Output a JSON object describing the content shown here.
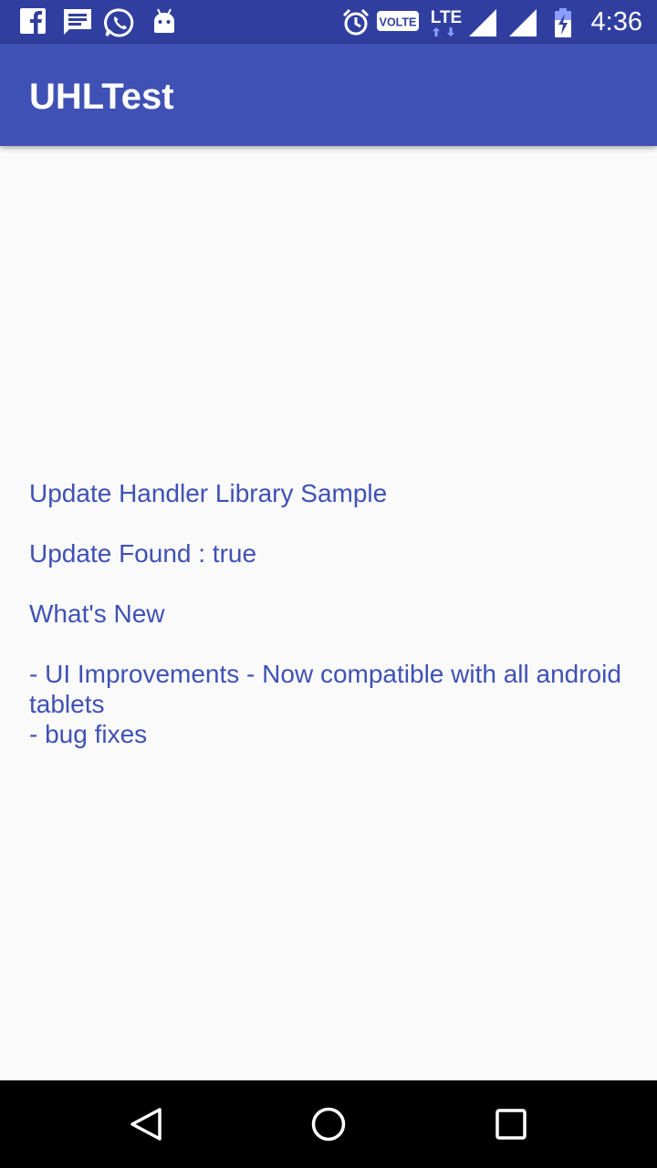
{
  "status_bar": {
    "time": "4:36",
    "volte_badge": "VOLTE",
    "network_type": "LTE",
    "notification_icons": [
      "facebook-icon",
      "message-icon",
      "whatsapp-icon",
      "android-icon"
    ],
    "system_icons": [
      "alarm-icon",
      "volte-icon",
      "lte-icon",
      "signal-icon",
      "signal-icon",
      "battery-charging-icon"
    ]
  },
  "app_bar": {
    "title": "UHLTest",
    "color": "#3f51b5"
  },
  "main": {
    "info_text": "Update Handler Library Sample\n\nUpdate Found : true\n\nWhat's New\n\n- UI Improvements - Now compatible with all android tablets\n- bug fixes",
    "text_color": "#3f51b5"
  },
  "nav_bar": {
    "buttons": [
      "back-icon",
      "home-icon",
      "recents-icon"
    ]
  },
  "colors": {
    "status_bar": "#303f9f",
    "primary": "#3f51b5",
    "background": "#fafafa",
    "nav_bar": "#000000"
  }
}
